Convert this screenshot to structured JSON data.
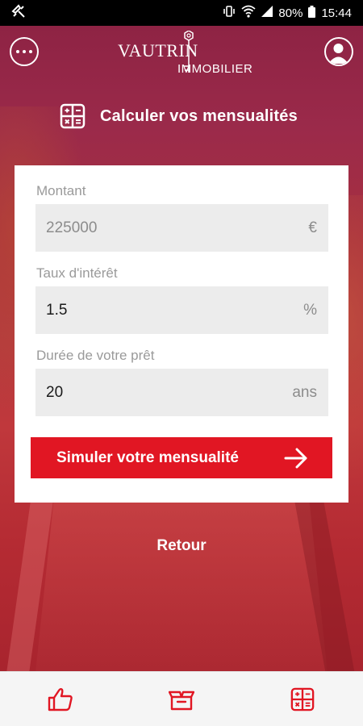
{
  "status_bar": {
    "battery": "80%",
    "time": "15:44"
  },
  "header": {
    "logo_main": "VAUTRIN",
    "logo_sub": "IMMOBILIER"
  },
  "page": {
    "title": "Calculer vos mensualités"
  },
  "form": {
    "amount": {
      "label": "Montant",
      "value": "225000",
      "unit": "€"
    },
    "rate": {
      "label": "Taux d'intérêt",
      "value": "1.5",
      "unit": "%"
    },
    "duration": {
      "label": "Durée de votre prêt",
      "value": "20",
      "unit": "ans"
    },
    "submit_label": "Simuler votre mensualité"
  },
  "back_label": "Retour",
  "colors": {
    "accent": "#e11623",
    "overlay": "#9b2a4a",
    "field_bg": "#ececec"
  },
  "icons": {
    "nav": [
      "thumbs-up-icon",
      "open-box-icon",
      "calculator-icon"
    ]
  }
}
